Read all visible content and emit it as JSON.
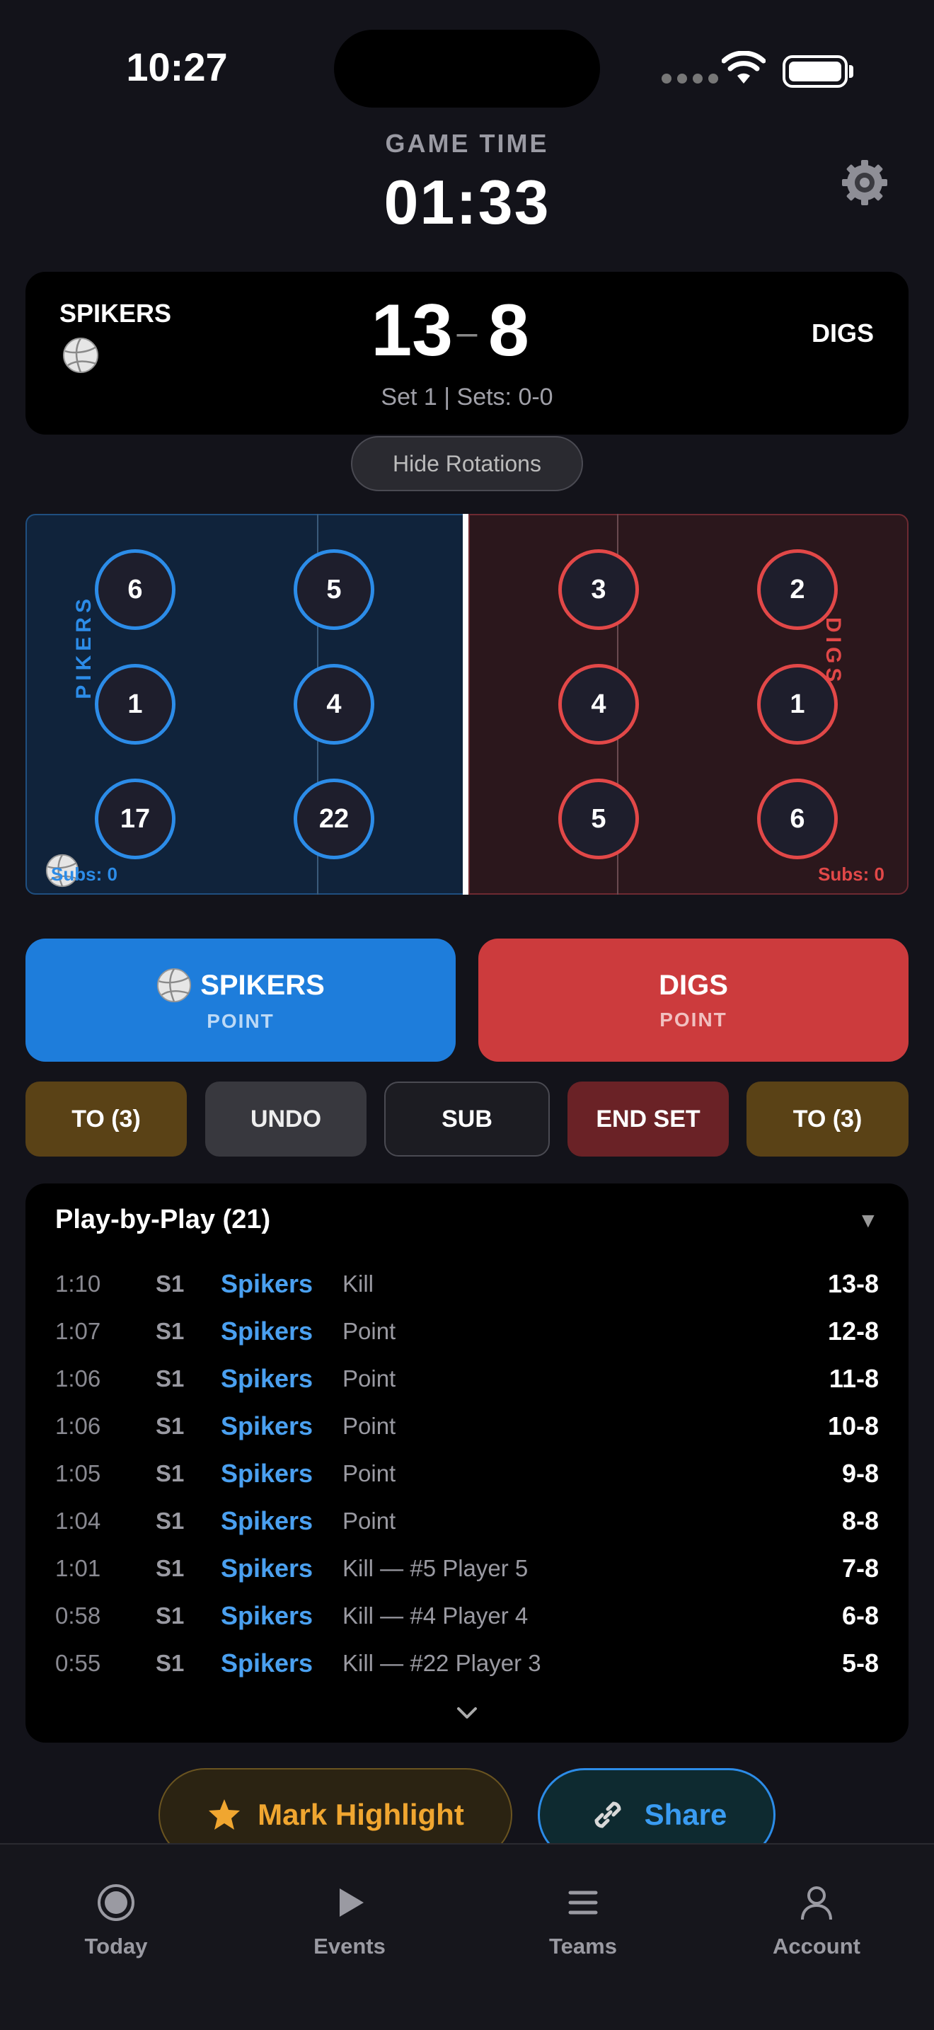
{
  "status_bar": {
    "time": "10:27"
  },
  "game_time": {
    "label": "GAME TIME",
    "clock": "01:33"
  },
  "scoreboard": {
    "team_left": "SPIKERS",
    "team_right": "DIGS",
    "score_left": "13",
    "score_right": "8",
    "separator": "–",
    "set_info": "Set 1 | Sets: 0-0"
  },
  "hide_rotations_label": "Hide Rotations",
  "court": {
    "left_label": "SPIKERS",
    "right_label": "DIGS",
    "left_players": [
      "6",
      "5",
      "1",
      "4",
      "17",
      "22"
    ],
    "right_players": [
      "3",
      "2",
      "4",
      "1",
      "5",
      "6"
    ],
    "left_subs": "Subs: 0",
    "right_subs": "Subs: 0"
  },
  "point_buttons": {
    "left_team": "SPIKERS",
    "left_sub": "POINT",
    "right_team": "DIGS",
    "right_sub": "POINT"
  },
  "actions": {
    "timeout_left": "TO (3)",
    "undo": "UNDO",
    "sub": "SUB",
    "end_set": "END SET",
    "timeout_right": "TO (3)"
  },
  "play_by_play": {
    "title": "Play-by-Play (21)",
    "rows": [
      {
        "time": "1:10",
        "set": "S1",
        "team": "Spikers",
        "desc": "Kill",
        "score": "13-8"
      },
      {
        "time": "1:07",
        "set": "S1",
        "team": "Spikers",
        "desc": "Point",
        "score": "12-8"
      },
      {
        "time": "1:06",
        "set": "S1",
        "team": "Spikers",
        "desc": "Point",
        "score": "11-8"
      },
      {
        "time": "1:06",
        "set": "S1",
        "team": "Spikers",
        "desc": "Point",
        "score": "10-8"
      },
      {
        "time": "1:05",
        "set": "S1",
        "team": "Spikers",
        "desc": "Point",
        "score": "9-8"
      },
      {
        "time": "1:04",
        "set": "S1",
        "team": "Spikers",
        "desc": "Point",
        "score": "8-8"
      },
      {
        "time": "1:01",
        "set": "S1",
        "team": "Spikers",
        "desc": "Kill — #5 Player 5",
        "score": "7-8"
      },
      {
        "time": "0:58",
        "set": "S1",
        "team": "Spikers",
        "desc": "Kill — #4 Player 4",
        "score": "6-8"
      },
      {
        "time": "0:55",
        "set": "S1",
        "team": "Spikers",
        "desc": "Kill — #22 Player 3",
        "score": "5-8"
      }
    ]
  },
  "bottom_buttons": {
    "highlight": "Mark Highlight",
    "share": "Share"
  },
  "tabs": [
    {
      "label": "Today",
      "icon": "record-icon"
    },
    {
      "label": "Events",
      "icon": "play-icon"
    },
    {
      "label": "Teams",
      "icon": "list-icon"
    },
    {
      "label": "Account",
      "icon": "person-icon"
    }
  ],
  "colors": {
    "blue": "#1e7ddb",
    "red": "#cc3b3d",
    "gold": "#f0a630"
  }
}
